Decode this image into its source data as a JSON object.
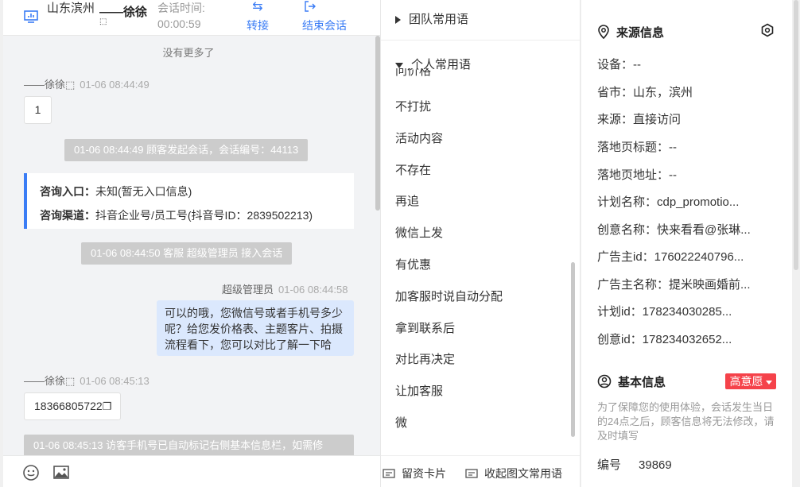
{
  "header": {
    "location": "山东滨州",
    "customer_name": "——徐徐",
    "customer_name_sub": "⬚",
    "session_time_label": "会话时间:",
    "session_time": "00:00:59",
    "transfer_label": "转接",
    "end_label": "结束会话"
  },
  "chat": {
    "no_more": "没有更多了",
    "msg1_sender": "——徐徐⬚",
    "msg1_time": "01-06 08:44:49",
    "msg1_text": "1",
    "sys1": "01-06 08:44:49 顾客发起会话，会话编号：44113",
    "card_entry_label": "咨询入口：",
    "card_entry_value": "未知(暂无入口信息)",
    "card_channel_label": "咨询渠道：",
    "card_channel_value": "抖音企业号/员工号(抖音号ID：2839502213)",
    "sys2": "01-06 08:44:50 客服 超级管理员 接入会话",
    "agent_name": "超级管理员",
    "agent_time": "01-06 08:44:58",
    "agent_text": "可以的哦，您微信号或者手机号多少呢？给您发价格表、主题客片、拍摄流程看下，您可以对比了解一下哈",
    "msg2_sender": "——徐徐⬚",
    "msg2_time": "01-06 08:45:13",
    "msg2_text": "18366805722",
    "sys3": "01-06 08:45:13 访客手机号已自动标记右侧基本信息栏，如需修"
  },
  "phrases": {
    "team_group": "团队常用语",
    "personal_group": "个人常用语",
    "partial_item": "问价格",
    "items": [
      "不打扰",
      "活动内容",
      "不存在",
      "再追",
      "微信上发",
      "有优惠",
      "加客服时说自动分配",
      "拿到联系后",
      "对比再决定",
      "让加客服",
      "微"
    ],
    "footer_card": "留资卡片",
    "footer_collapse": "收起图文常用语"
  },
  "info": {
    "source_title": "来源信息",
    "rows": [
      "设备：--",
      "省市：山东，滨州",
      "来源：直接访问",
      "落地页标题：--",
      "落地页地址：--",
      "计划名称：cdp_promotio...",
      "创意名称：快来看看@张琳...",
      "广告主id：176022240796...",
      "广告主名称：提米映画婚前...",
      "计划id：178234030285...",
      "创意id：178234032652..."
    ],
    "basic_title": "基本信息",
    "intent_badge": "高意愿",
    "note": "为了保障您的使用体验，会话发生当日的24点之后，顾客信息将无法修改，请及时填写",
    "id_label": "编号",
    "id_value": "39869"
  },
  "colors": {
    "accent": "#3a7cf5",
    "badge": "#f5424a",
    "agent_bubble": "#dbe8fd"
  }
}
